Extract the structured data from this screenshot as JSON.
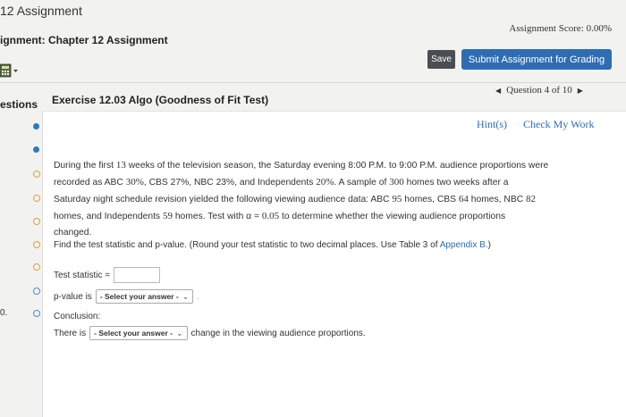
{
  "header": {
    "title": "12 Assignment",
    "assignment_label": "ignment: Chapter 12 Assignment",
    "score": "Assignment Score: 0.00%",
    "save_label": "Save",
    "submit_label": "Submit Assignment for Grading"
  },
  "nav": {
    "questions_label": "estions",
    "exercise_title": "Exercise 12.03 Algo (Goodness of Fit Test)",
    "question_position": "Question 4 of 10",
    "side_number": "0."
  },
  "tools": {
    "hint": "Hint(s)",
    "check": "Check My Work"
  },
  "problem": {
    "line1a": "During the first ",
    "weeks": "13",
    "line1b": " weeks of the television season, the Saturday evening 8:00 P.M. to 9:00 P.M. audience proportions were",
    "line2a": "recorded as ABC ",
    "abc_pct": "30%",
    "line2b": ", CBS ",
    "cbs_pct": "27%",
    "line2c": ", NBC ",
    "nbc_pct": "23%",
    "line2d": ", and Independents ",
    "ind_pct": "20%",
    "line2e": ". A sample of ",
    "sample": "300",
    "line2f": " homes two weeks after a",
    "line3a": "Saturday night schedule revision yielded the following viewing audience data: ABC ",
    "abc_n": "95",
    "line3b": " homes, CBS ",
    "cbs_n": "64",
    "line3c": " homes, NBC ",
    "nbc_n": "82",
    "line4a": "homes, and Independents ",
    "ind_n": "59",
    "line4b": " homes. Test with α = ",
    "alpha": "0.05",
    "line4c": " to determine whether the viewing audience proportions",
    "line5": "changed."
  },
  "instructions": {
    "text": "Find the test statistic and p-value. (Round your test statistic to two decimal places. Use Table 3 of ",
    "link": "Appendix B.",
    "close": ")"
  },
  "fields": {
    "test_statistic_label": "Test statistic =",
    "test_statistic_value": "",
    "p_value_label": "p-value is",
    "p_value_select": "- Select your answer -",
    "conclusion_label": "Conclusion:",
    "there_is": "There is",
    "conclusion_select": "- Select your answer -",
    "conclusion_tail": "change in the viewing audience proportions."
  },
  "colors": {
    "accent": "#2e6db3",
    "save_bg": "#4a4d52",
    "dot_blue": "#2a7bc0",
    "ring_orange": "#e0a238"
  }
}
